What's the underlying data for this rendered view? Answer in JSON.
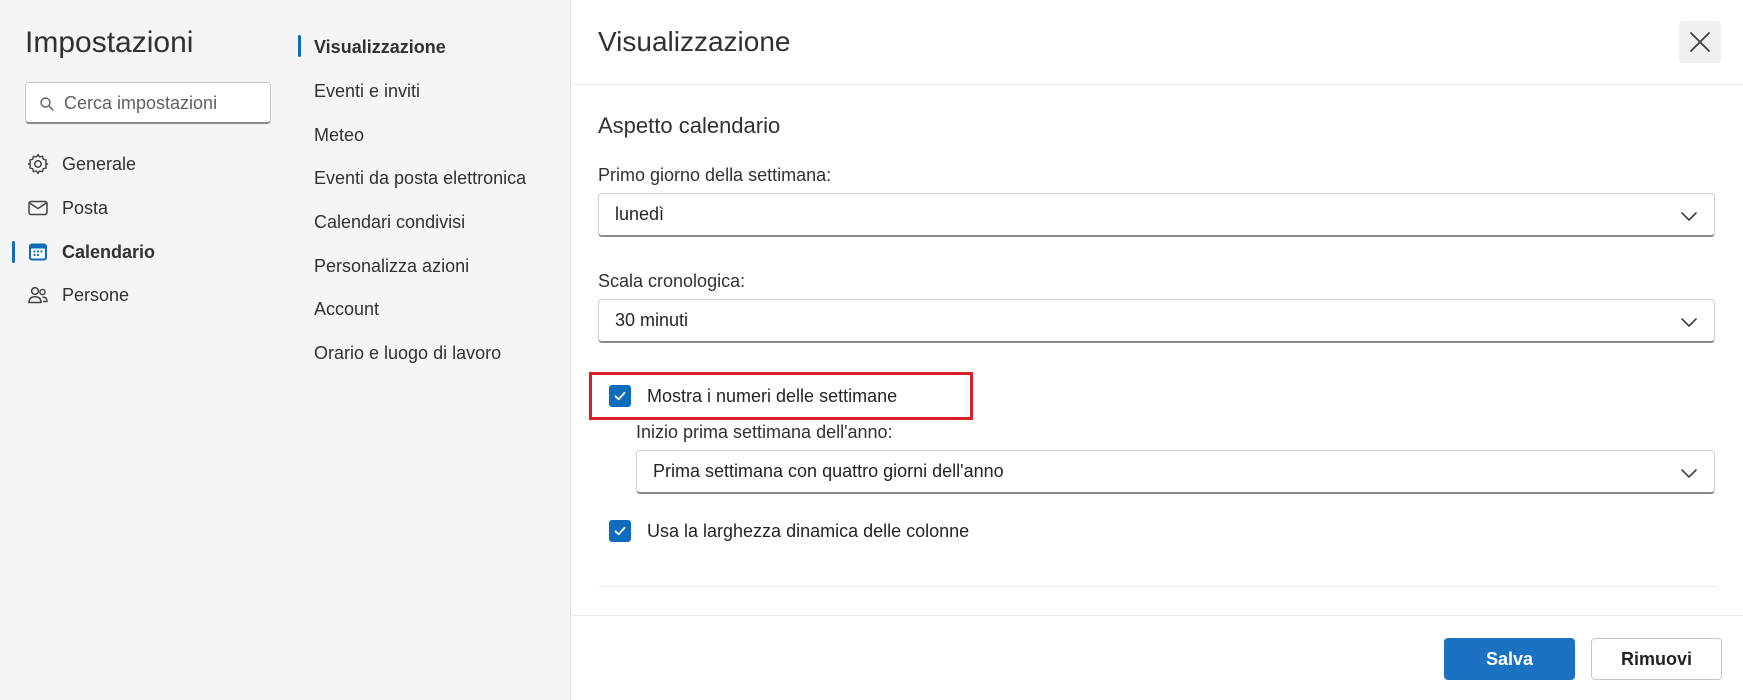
{
  "app": {
    "title": "Impostazioni"
  },
  "search": {
    "placeholder": "Cerca impostazioni"
  },
  "sidebar": {
    "items": [
      {
        "label": "Generale",
        "icon": "gear-icon"
      },
      {
        "label": "Posta",
        "icon": "mail-icon"
      },
      {
        "label": "Calendario",
        "icon": "calendar-icon",
        "active": true
      },
      {
        "label": "Persone",
        "icon": "people-icon"
      }
    ]
  },
  "subnav": {
    "items": [
      {
        "label": "Visualizzazione",
        "active": true
      },
      {
        "label": "Eventi e inviti"
      },
      {
        "label": "Meteo"
      },
      {
        "label": "Eventi da posta elettronica"
      },
      {
        "label": "Calendari condivisi"
      },
      {
        "label": "Personalizza azioni"
      },
      {
        "label": "Account"
      },
      {
        "label": "Orario e luogo di lavoro"
      }
    ]
  },
  "panel": {
    "title": "Visualizzazione",
    "section_title": "Aspetto calendario",
    "first_day": {
      "label": "Primo giorno della settimana:",
      "value": "lunedì"
    },
    "time_scale": {
      "label": "Scala cronologica:",
      "value": "30 minuti"
    },
    "show_week_numbers": {
      "label": "Mostra i numeri delle settimane",
      "checked": true
    },
    "first_week": {
      "label": "Inizio prima settimana dell'anno:",
      "value": "Prima settimana con quattro giorni dell'anno"
    },
    "dynamic_width": {
      "label": "Usa la larghezza dinamica delle colonne",
      "checked": true
    }
  },
  "footer": {
    "save_label": "Salva",
    "remove_label": "Rimuovi"
  },
  "colors": {
    "accent": "#0f6cbd",
    "save_button": "#1b72c2",
    "highlight": "#d81f26",
    "nav_background": "#f5f5f5"
  }
}
